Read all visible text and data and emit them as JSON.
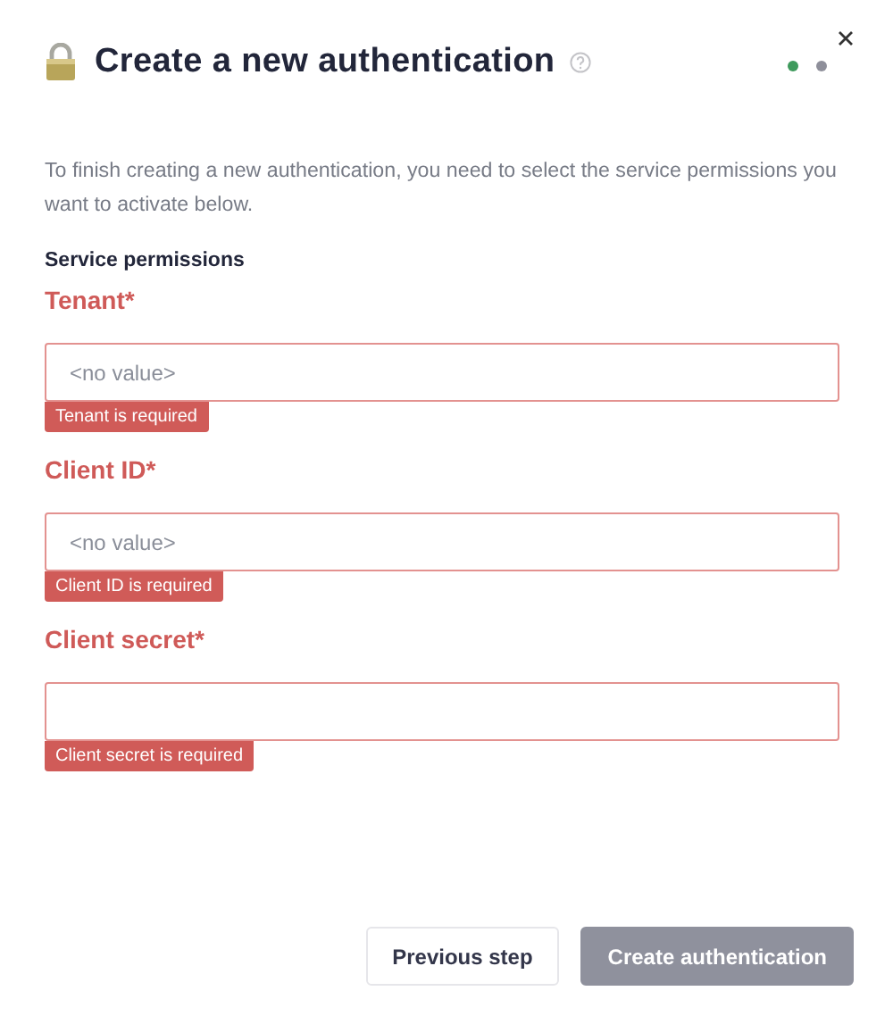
{
  "dialog": {
    "title": "Create a new authentication",
    "steps": [
      {
        "selected": true
      },
      {
        "selected": false
      }
    ]
  },
  "description": "To finish creating a new authentication, you need to select the service permissions you want to activate below.",
  "section_title": "Service permissions",
  "fields": [
    {
      "label": "Tenant*",
      "placeholder": "<no value>",
      "invalid": true,
      "error": "Tenant is required"
    },
    {
      "label": "Client ID*",
      "placeholder": "<no value>",
      "invalid": true,
      "error": "Client ID is required"
    },
    {
      "label": "Client secret*",
      "invalid": true,
      "error": "Client secret is required"
    }
  ],
  "buttons": [
    {
      "label": "Previous step",
      "kind": "secondary",
      "disabled": false
    },
    {
      "label": "Create authentication",
      "kind": "primary",
      "disabled": true
    }
  ]
}
